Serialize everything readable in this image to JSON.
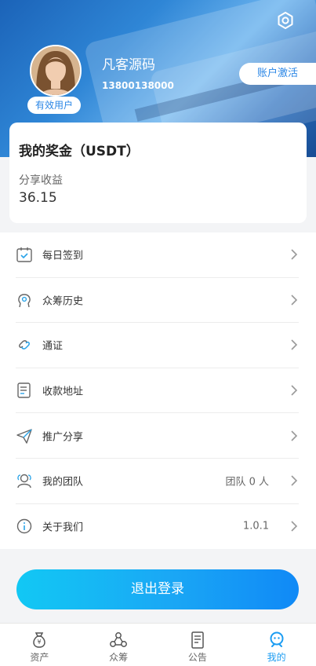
{
  "header": {
    "user_name": "凡客源码",
    "phone": "13800138000",
    "badge": "有效用户",
    "activate_label": "账户激活"
  },
  "reward": {
    "title": "我的奖金（USDT）",
    "share_label": "分享收益",
    "share_value": "36.15"
  },
  "menu": [
    {
      "label": "每日签到",
      "icon": "calendar-check-icon",
      "value": ""
    },
    {
      "label": "众筹历史",
      "icon": "history-icon",
      "value": ""
    },
    {
      "label": "通证",
      "icon": "token-link-icon",
      "value": ""
    },
    {
      "label": "收款地址",
      "icon": "address-doc-icon",
      "value": ""
    },
    {
      "label": "推广分享",
      "icon": "paper-plane-icon",
      "value": ""
    },
    {
      "label": "我的团队",
      "icon": "team-icon",
      "value": "团队 0 人"
    },
    {
      "label": "关于我们",
      "icon": "info-icon",
      "value": "1.0.1"
    }
  ],
  "logout_label": "退出登录",
  "tabs": [
    {
      "label": "资产",
      "icon": "money-bag-icon"
    },
    {
      "label": "众筹",
      "icon": "crowdfund-icon"
    },
    {
      "label": "公告",
      "icon": "notice-icon"
    },
    {
      "label": "我的",
      "icon": "profile-icon"
    }
  ],
  "colors": {
    "accent": "#1b9cf2",
    "gradient_start": "#12c8f4",
    "gradient_end": "#1089f6"
  }
}
